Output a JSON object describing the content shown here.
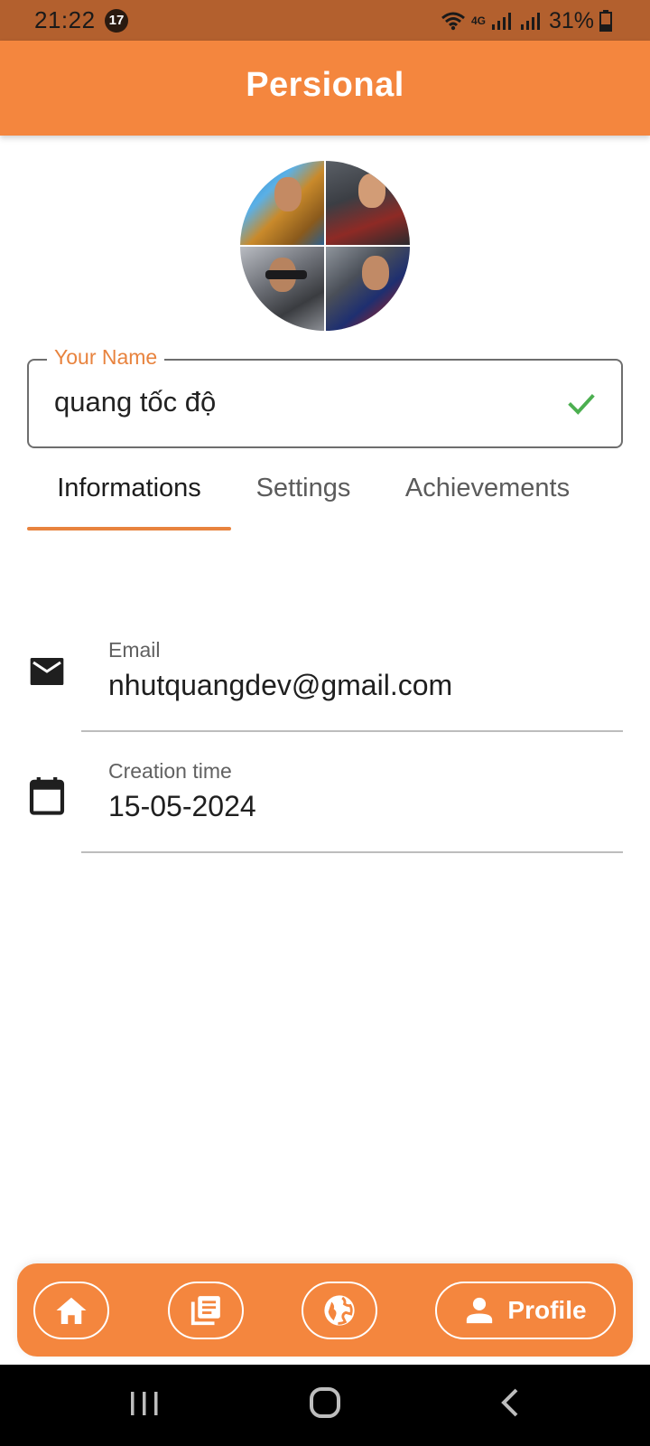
{
  "status_bar": {
    "time": "21:22",
    "notification_count": "17",
    "network_label": "4G",
    "battery": "31%",
    "icons": [
      "wifi-icon",
      "signal-icon",
      "battery-icon"
    ]
  },
  "app_bar": {
    "title": "Persional"
  },
  "avatar": {
    "description": "collage-avatar"
  },
  "name_field": {
    "label": "Your Name",
    "value": "quang tốc độ",
    "status_icon": "check-icon"
  },
  "tabs": [
    {
      "label": "Informations",
      "active": true
    },
    {
      "label": "Settings",
      "active": false
    },
    {
      "label": "Achievements",
      "active": false
    }
  ],
  "info": {
    "email": {
      "icon": "mail-icon",
      "label": "Email",
      "value": "nhutquangdev@gmail.com"
    },
    "created": {
      "icon": "calendar-icon",
      "label": "Creation time",
      "value": "15-05-2024"
    }
  },
  "bottom_nav": {
    "items": [
      {
        "icon": "home-icon"
      },
      {
        "icon": "news-icon"
      },
      {
        "icon": "globe-icon"
      },
      {
        "icon": "person-icon",
        "label": "Profile",
        "active": true
      }
    ]
  },
  "system_nav": {
    "icons": [
      "recents-icon",
      "home-circle-icon",
      "back-icon"
    ]
  },
  "colors": {
    "accent": "#f4863e",
    "status_bar": "#b3602e",
    "check": "#4caf50",
    "tab_indicator": "#e8833e"
  }
}
